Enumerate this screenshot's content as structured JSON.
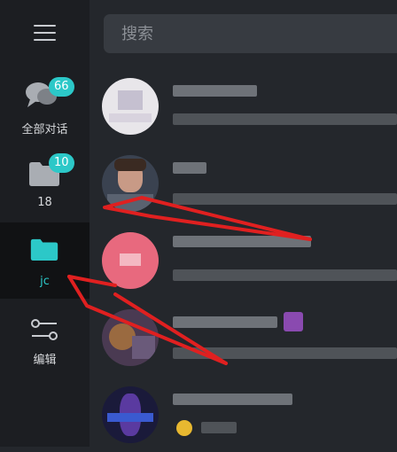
{
  "sidebar": {
    "items": [
      {
        "label": "全部对话",
        "badge": "66",
        "icon": "chat-bubbles-icon"
      },
      {
        "label": "18",
        "badge": "10",
        "icon": "folder-icon"
      },
      {
        "label": "jc",
        "icon": "folder-icon",
        "active": true
      },
      {
        "label": "编辑",
        "icon": "sliders-icon"
      }
    ]
  },
  "search": {
    "placeholder": "搜索"
  },
  "colors": {
    "accent": "#2cc8c8",
    "sidebar_bg": "#1c1e22",
    "main_bg": "#24272c",
    "annotation_arrow": "#e02020"
  }
}
